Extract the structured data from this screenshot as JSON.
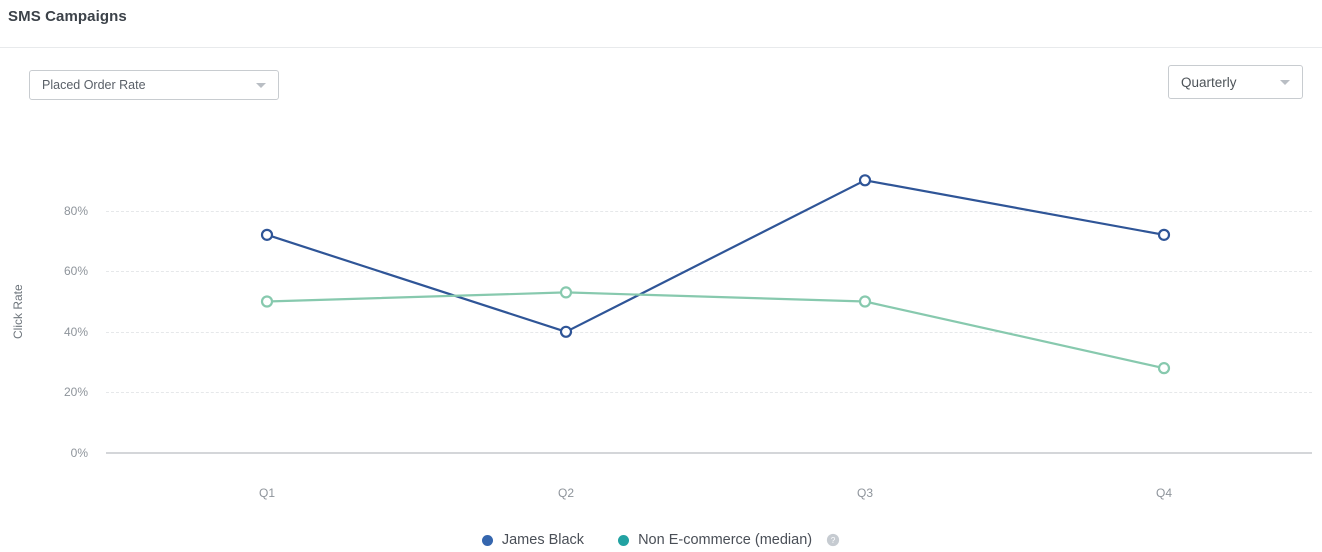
{
  "page_title": "SMS Campaigns",
  "toolbar": {
    "metric_select": {
      "value": "Placed Order Rate",
      "caret_icon": "chevron-down-icon"
    },
    "interval_select": {
      "value": "Quarterly",
      "caret_icon": "chevron-down-icon"
    }
  },
  "legend": {
    "items": [
      {
        "label": "James Black",
        "color": "#3566ae"
      },
      {
        "label": "Non E-commerce (median)",
        "color": "#22a2a2"
      }
    ],
    "help_icon": "help-circle-icon"
  },
  "colors": {
    "series_primary": "#2f5597",
    "series_secondary": "#87c9ae",
    "gridline": "#e6e8ea",
    "baseline": "#d4d6d9",
    "axis_text": "#8e949b",
    "title_text": "#3c4249"
  },
  "chart_data": {
    "type": "line",
    "title": "",
    "xlabel": "",
    "ylabel": "Click Rate",
    "categories": [
      "Q1",
      "Q2",
      "Q3",
      "Q4"
    ],
    "ylim": [
      0,
      90
    ],
    "y_ticks": [
      "0%",
      "20%",
      "40%",
      "60%",
      "80%"
    ],
    "y_tick_values": [
      0,
      20,
      40,
      60,
      80
    ],
    "grid": true,
    "legend_position": "bottom",
    "series": [
      {
        "name": "James Black",
        "color": "#2f5597",
        "values": [
          72,
          40,
          90,
          72
        ]
      },
      {
        "name": "Non E-commerce (median)",
        "color": "#87c9ae",
        "values": [
          50,
          53,
          50,
          28
        ]
      }
    ]
  }
}
